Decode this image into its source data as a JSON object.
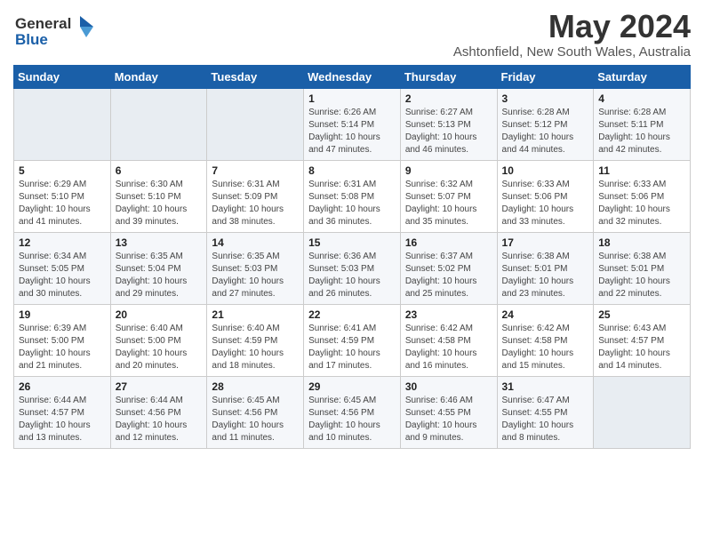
{
  "logo": {
    "text_general": "General",
    "text_blue": "Blue"
  },
  "header": {
    "month_year": "May 2024",
    "location": "Ashtonfield, New South Wales, Australia"
  },
  "days_of_week": [
    "Sunday",
    "Monday",
    "Tuesday",
    "Wednesday",
    "Thursday",
    "Friday",
    "Saturday"
  ],
  "weeks": [
    [
      {
        "day": "",
        "info": ""
      },
      {
        "day": "",
        "info": ""
      },
      {
        "day": "",
        "info": ""
      },
      {
        "day": "1",
        "info": "Sunrise: 6:26 AM\nSunset: 5:14 PM\nDaylight: 10 hours and 47 minutes."
      },
      {
        "day": "2",
        "info": "Sunrise: 6:27 AM\nSunset: 5:13 PM\nDaylight: 10 hours and 46 minutes."
      },
      {
        "day": "3",
        "info": "Sunrise: 6:28 AM\nSunset: 5:12 PM\nDaylight: 10 hours and 44 minutes."
      },
      {
        "day": "4",
        "info": "Sunrise: 6:28 AM\nSunset: 5:11 PM\nDaylight: 10 hours and 42 minutes."
      }
    ],
    [
      {
        "day": "5",
        "info": "Sunrise: 6:29 AM\nSunset: 5:10 PM\nDaylight: 10 hours and 41 minutes."
      },
      {
        "day": "6",
        "info": "Sunrise: 6:30 AM\nSunset: 5:10 PM\nDaylight: 10 hours and 39 minutes."
      },
      {
        "day": "7",
        "info": "Sunrise: 6:31 AM\nSunset: 5:09 PM\nDaylight: 10 hours and 38 minutes."
      },
      {
        "day": "8",
        "info": "Sunrise: 6:31 AM\nSunset: 5:08 PM\nDaylight: 10 hours and 36 minutes."
      },
      {
        "day": "9",
        "info": "Sunrise: 6:32 AM\nSunset: 5:07 PM\nDaylight: 10 hours and 35 minutes."
      },
      {
        "day": "10",
        "info": "Sunrise: 6:33 AM\nSunset: 5:06 PM\nDaylight: 10 hours and 33 minutes."
      },
      {
        "day": "11",
        "info": "Sunrise: 6:33 AM\nSunset: 5:06 PM\nDaylight: 10 hours and 32 minutes."
      }
    ],
    [
      {
        "day": "12",
        "info": "Sunrise: 6:34 AM\nSunset: 5:05 PM\nDaylight: 10 hours and 30 minutes."
      },
      {
        "day": "13",
        "info": "Sunrise: 6:35 AM\nSunset: 5:04 PM\nDaylight: 10 hours and 29 minutes."
      },
      {
        "day": "14",
        "info": "Sunrise: 6:35 AM\nSunset: 5:03 PM\nDaylight: 10 hours and 27 minutes."
      },
      {
        "day": "15",
        "info": "Sunrise: 6:36 AM\nSunset: 5:03 PM\nDaylight: 10 hours and 26 minutes."
      },
      {
        "day": "16",
        "info": "Sunrise: 6:37 AM\nSunset: 5:02 PM\nDaylight: 10 hours and 25 minutes."
      },
      {
        "day": "17",
        "info": "Sunrise: 6:38 AM\nSunset: 5:01 PM\nDaylight: 10 hours and 23 minutes."
      },
      {
        "day": "18",
        "info": "Sunrise: 6:38 AM\nSunset: 5:01 PM\nDaylight: 10 hours and 22 minutes."
      }
    ],
    [
      {
        "day": "19",
        "info": "Sunrise: 6:39 AM\nSunset: 5:00 PM\nDaylight: 10 hours and 21 minutes."
      },
      {
        "day": "20",
        "info": "Sunrise: 6:40 AM\nSunset: 5:00 PM\nDaylight: 10 hours and 20 minutes."
      },
      {
        "day": "21",
        "info": "Sunrise: 6:40 AM\nSunset: 4:59 PM\nDaylight: 10 hours and 18 minutes."
      },
      {
        "day": "22",
        "info": "Sunrise: 6:41 AM\nSunset: 4:59 PM\nDaylight: 10 hours and 17 minutes."
      },
      {
        "day": "23",
        "info": "Sunrise: 6:42 AM\nSunset: 4:58 PM\nDaylight: 10 hours and 16 minutes."
      },
      {
        "day": "24",
        "info": "Sunrise: 6:42 AM\nSunset: 4:58 PM\nDaylight: 10 hours and 15 minutes."
      },
      {
        "day": "25",
        "info": "Sunrise: 6:43 AM\nSunset: 4:57 PM\nDaylight: 10 hours and 14 minutes."
      }
    ],
    [
      {
        "day": "26",
        "info": "Sunrise: 6:44 AM\nSunset: 4:57 PM\nDaylight: 10 hours and 13 minutes."
      },
      {
        "day": "27",
        "info": "Sunrise: 6:44 AM\nSunset: 4:56 PM\nDaylight: 10 hours and 12 minutes."
      },
      {
        "day": "28",
        "info": "Sunrise: 6:45 AM\nSunset: 4:56 PM\nDaylight: 10 hours and 11 minutes."
      },
      {
        "day": "29",
        "info": "Sunrise: 6:45 AM\nSunset: 4:56 PM\nDaylight: 10 hours and 10 minutes."
      },
      {
        "day": "30",
        "info": "Sunrise: 6:46 AM\nSunset: 4:55 PM\nDaylight: 10 hours and 9 minutes."
      },
      {
        "day": "31",
        "info": "Sunrise: 6:47 AM\nSunset: 4:55 PM\nDaylight: 10 hours and 8 minutes."
      },
      {
        "day": "",
        "info": ""
      }
    ]
  ]
}
